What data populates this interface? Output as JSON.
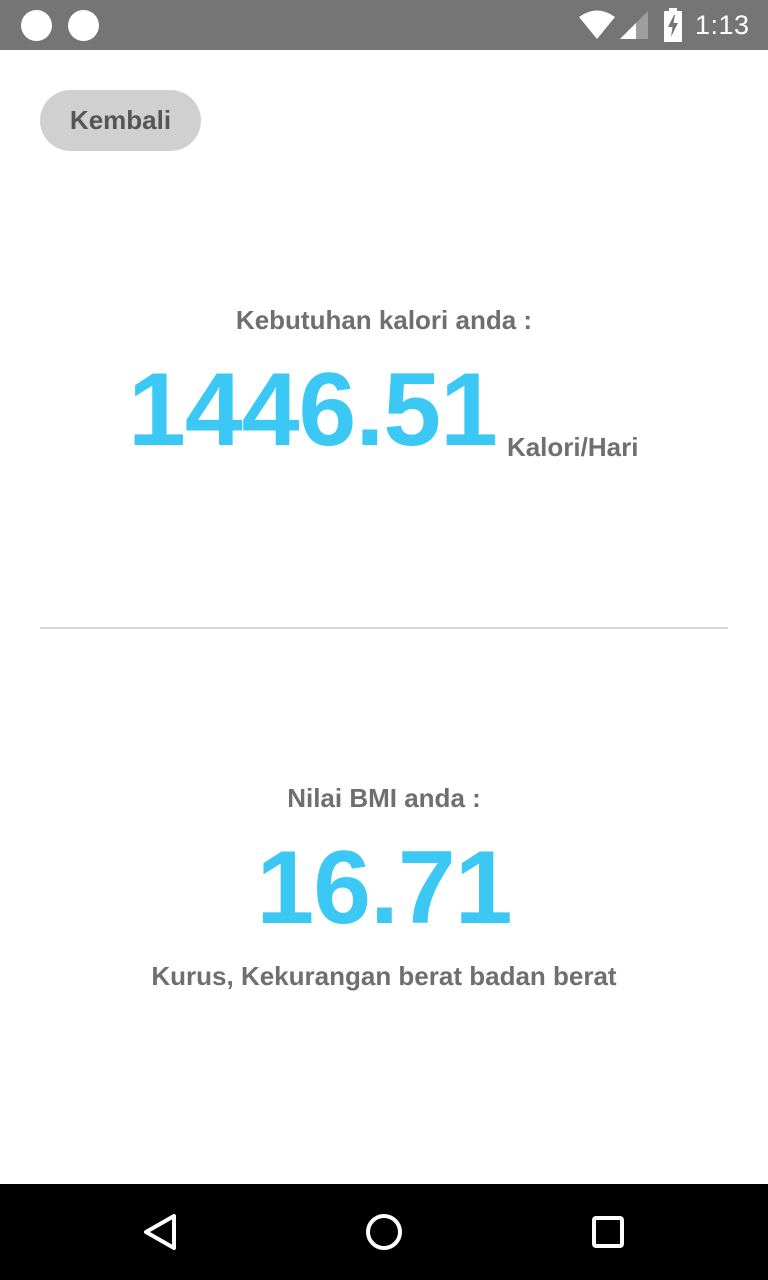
{
  "status_bar": {
    "time": "1:13",
    "icons": [
      "notification-dot-icon",
      "notification-dot-icon",
      "wifi-icon",
      "signal-icon",
      "battery-charging-icon"
    ]
  },
  "header": {
    "back_label": "Kembali"
  },
  "calorie": {
    "label": "Kebutuhan kalori anda :",
    "value": "1446.51",
    "unit": "Kalori/Hari"
  },
  "bmi": {
    "label": "Nilai BMI anda :",
    "value": "16.71",
    "status": "Kurus, Kekurangan berat badan berat"
  },
  "nav_bar": {
    "icons": [
      "back-triangle-icon",
      "home-circle-icon",
      "recents-square-icon"
    ]
  },
  "colors": {
    "accent": "#3cc8f5",
    "label_text": "#6f6f6f",
    "status_bar": "#757575",
    "button_bg": "#d0d0d0"
  }
}
